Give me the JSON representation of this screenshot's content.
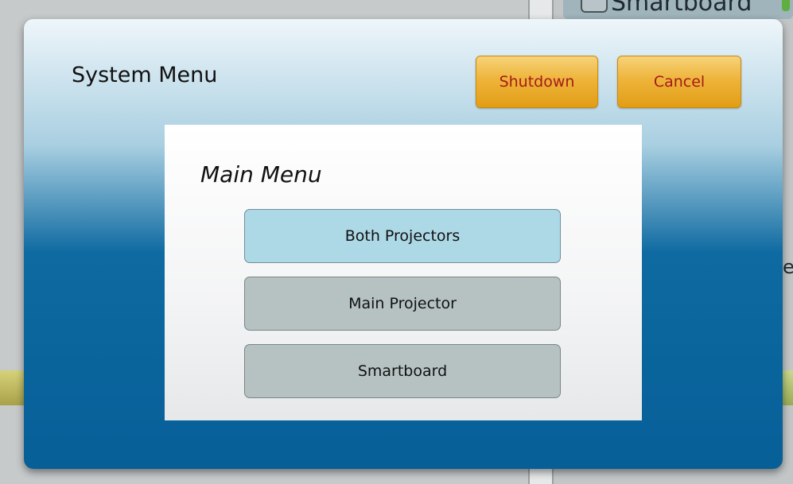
{
  "background": {
    "right_device_label": "Smartboard",
    "right_device_icon": "monitor-icon",
    "edge_glyph": "e"
  },
  "dialog": {
    "title": "System Menu",
    "shutdown_label": "Shutdown",
    "cancel_label": "Cancel"
  },
  "main_menu": {
    "title": "Main Menu",
    "items": [
      {
        "label": "Both Projectors",
        "selected": true
      },
      {
        "label": "Main Projector",
        "selected": false
      },
      {
        "label": "Smartboard",
        "selected": false
      }
    ]
  },
  "colors": {
    "dialog_top": "#eef6fa",
    "dialog_bottom": "#075f98",
    "amber_button": "#eeb43a",
    "amber_text": "#a41c1c",
    "selected_item": "#add8e6",
    "item": "#b6c2c2"
  }
}
